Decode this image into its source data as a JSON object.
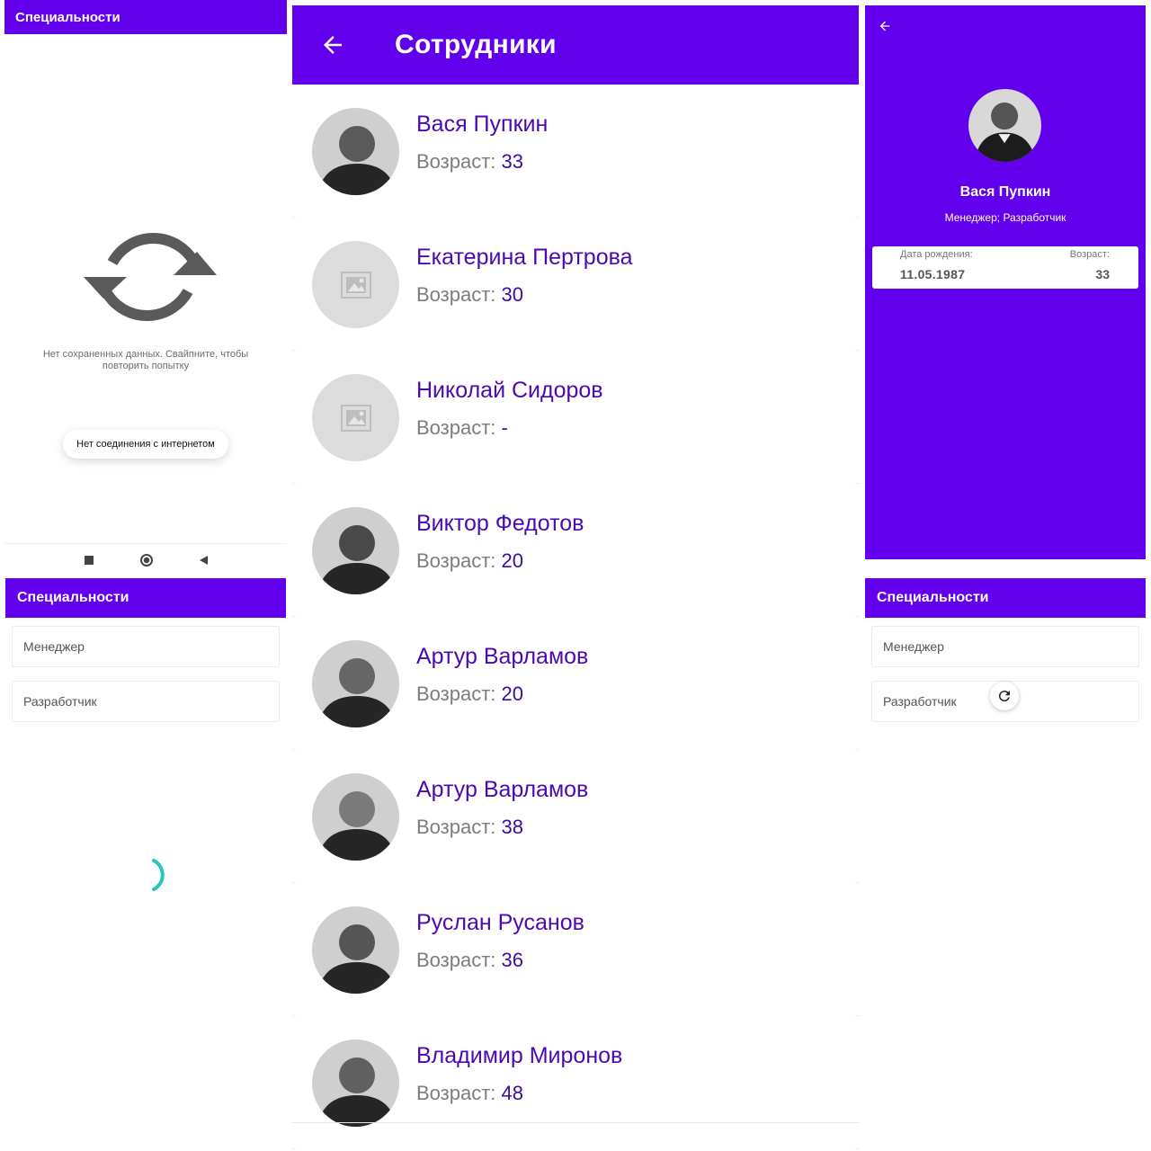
{
  "offline_screen": {
    "title": "Специальности",
    "message": "Нет сохраненных данных. Свайпните, чтобы повторить попытку",
    "toast": "Нет соединения с интернетом",
    "icon": "refresh-icon"
  },
  "employees_screen": {
    "title": "Сотрудники",
    "back_icon": "arrow-back-icon",
    "age_label": "Возраст: ",
    "employees": [
      {
        "name": "Вася Пупкин",
        "age": "33",
        "avatar": "photo"
      },
      {
        "name": "Екатерина Пертрова",
        "age": "30",
        "avatar": "placeholder"
      },
      {
        "name": "Николай Сидоров",
        "age": "-",
        "avatar": "placeholder"
      },
      {
        "name": "Виктор Федотов",
        "age": "20",
        "avatar": "photo"
      },
      {
        "name": "Артур Варламов",
        "age": "20",
        "avatar": "photo"
      },
      {
        "name": "Артур Варламов",
        "age": "38",
        "avatar": "photo"
      },
      {
        "name": "Руслан Русанов",
        "age": "36",
        "avatar": "photo"
      },
      {
        "name": "Владимир Миронов",
        "age": "48",
        "avatar": "photo"
      }
    ]
  },
  "detail_screen": {
    "name": "Вася Пупкин",
    "roles": "Менеджер; Разработчик",
    "birth_label": "Дата рождения:",
    "birth_value": "11.05.1987",
    "age_label": "Возраст:",
    "age_value": "33"
  },
  "specialties_loading": {
    "title": "Специальности",
    "items": [
      "Менеджер",
      "Разработчик"
    ]
  },
  "specialties_refresh": {
    "title": "Специальности",
    "items": [
      "Менеджер",
      "Разработчик"
    ]
  },
  "colors": {
    "primary": "#6200ee",
    "name_text": "#4a0ab0",
    "age_value": "#3c0aa6",
    "spinner": "#26c6c6"
  }
}
